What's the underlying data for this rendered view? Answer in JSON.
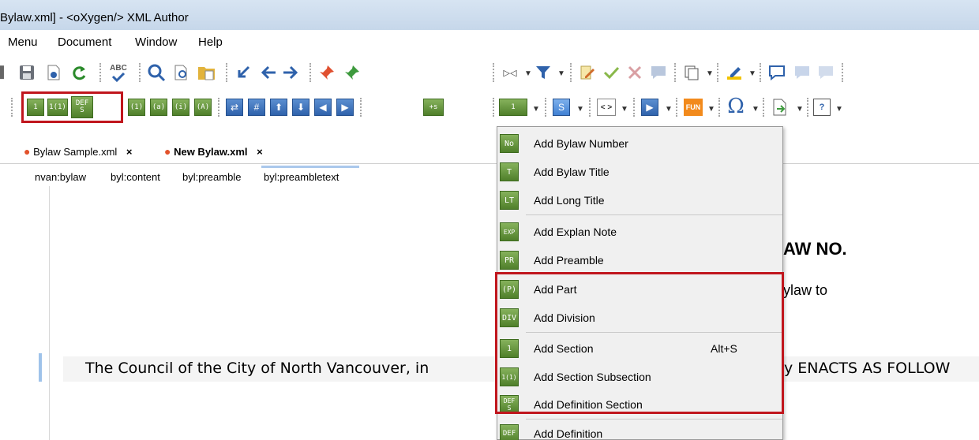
{
  "window": {
    "title": "Bylaw.xml] - <oXygen/> XML Author"
  },
  "menu": {
    "items": [
      "Menu",
      "Document",
      "Window",
      "Help"
    ]
  },
  "toolbar2": {
    "btn_1": "1",
    "btn_11": "1(1)",
    "btn_defs_top": "DEF",
    "btn_defs_bottom": "S",
    "btn_p": "(1)",
    "btn_a": "(a)",
    "btn_i": "(i)",
    "btn_A": "(A)",
    "btn_hash": "#",
    "btn_plus_s": "+s",
    "combo_1": "1",
    "combo_s": "S",
    "combo_tag": "< >",
    "combo_fun": "FUN",
    "combo_omega": "Ω",
    "combo_q": "?"
  },
  "toolbar1": {
    "spell": "ABC"
  },
  "tabs": [
    {
      "label": "Bylaw Sample.xml",
      "close": "×",
      "active": false
    },
    {
      "label": "New Bylaw.xml",
      "close": "×",
      "active": true
    }
  ],
  "breadcrumb": [
    "nvan:bylaw",
    "byl:content",
    "byl:preamble",
    "byl:preambletext"
  ],
  "document": {
    "heading_fragment": "AW NO.",
    "long_title_fragment": "ylaw to",
    "preamble_left": "The Council of the City of North Vancouver, in",
    "preamble_right": "y ENACTS AS FOLLOW"
  },
  "dropdown": {
    "items": [
      {
        "icon": "No",
        "label": "Add Bylaw Number",
        "shortcut": ""
      },
      {
        "icon": "T",
        "label": "Add Bylaw Title",
        "shortcut": ""
      },
      {
        "icon": "LT",
        "label": "Add Long Title",
        "shortcut": ""
      },
      {
        "icon": "EXP",
        "label": "Add Explan Note",
        "shortcut": ""
      },
      {
        "icon": "PR",
        "label": "Add Preamble",
        "shortcut": ""
      },
      {
        "icon": "(P)",
        "label": "Add Part",
        "shortcut": ""
      },
      {
        "icon": "DIV",
        "label": "Add Division",
        "shortcut": ""
      },
      {
        "icon": "1",
        "label": "Add Section",
        "shortcut": "Alt+S"
      },
      {
        "icon": "1(1)",
        "label": "Add Section Subsection",
        "shortcut": ""
      },
      {
        "icon": "DEF S",
        "label": "Add Definition Section",
        "shortcut": ""
      },
      {
        "icon": "DEF",
        "label": "Add Definition",
        "shortcut": ""
      }
    ]
  },
  "colors": {
    "accent_red": "#c0161d",
    "green_icon": "#5b8c33",
    "blue_icon": "#2f62ab"
  }
}
